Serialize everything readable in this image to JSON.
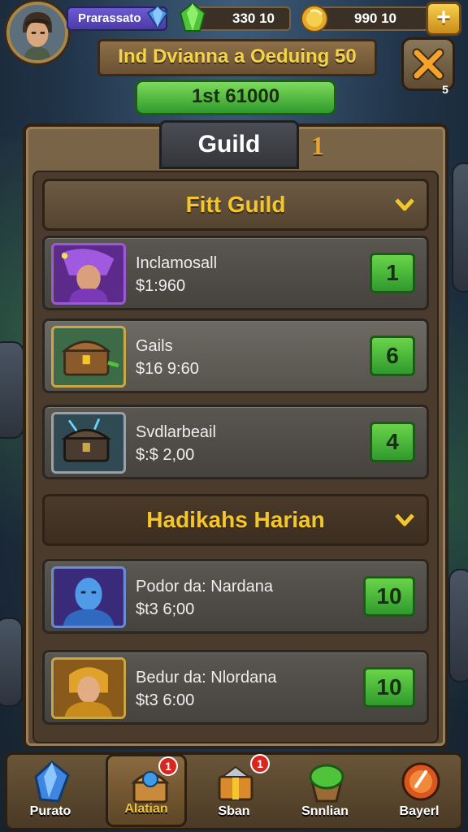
{
  "player": {
    "name": "Prarassato"
  },
  "resources": [
    {
      "value": "330 10",
      "icon": "green-gem-icon"
    },
    {
      "value": "990 10",
      "icon": "gold-coin-icon"
    }
  ],
  "event": {
    "title": "Ind Dvianna a Oeduing 50",
    "rank": "1st 61000"
  },
  "close_badge": "5",
  "tabs": {
    "active": "Guild",
    "count": "1"
  },
  "sections": [
    {
      "title": "Fitt Guild",
      "items": [
        {
          "title": "Inclamosall",
          "price": "$1:960",
          "qty": "1",
          "icon": "purple-hero-icon"
        },
        {
          "title": "Gails",
          "price": "$16 9:60",
          "qty": "6",
          "icon": "treasure-chest-icon"
        },
        {
          "title": "Svdlarbeail",
          "price": "$:$ 2,00",
          "qty": "4",
          "icon": "dark-chest-icon"
        }
      ]
    },
    {
      "title": "Hadikahs Harian",
      "items": [
        {
          "title": "Podor da: Nardana",
          "price": "$t3 6;00",
          "qty": "10",
          "icon": "blue-warrior-icon"
        },
        {
          "title": "Bedur da: Nlordana",
          "price": "$t3 6:00",
          "qty": "10",
          "icon": "golden-hero-icon"
        }
      ]
    }
  ],
  "nav": [
    {
      "label": "Purato",
      "icon": "blue-crystal-icon"
    },
    {
      "label": "Alatian",
      "icon": "blue-chest-icon",
      "badge": "1",
      "active": true
    },
    {
      "label": "Sban",
      "icon": "gift-chest-icon",
      "badge": "1"
    },
    {
      "label": "Snnlian",
      "icon": "green-pot-icon"
    },
    {
      "label": "Bayerl",
      "icon": "orange-emblem-icon"
    }
  ],
  "colors": {
    "accent_gold": "#f3c62b",
    "qty_green": "#2f9a2d",
    "panel_brown": "#5b4732"
  }
}
